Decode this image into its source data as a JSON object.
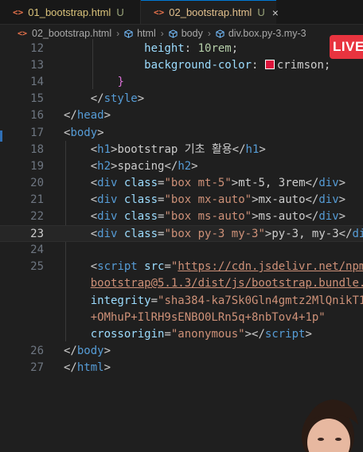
{
  "tabs": [
    {
      "icon": "<>",
      "label": "01_bootstrap.html",
      "modified": "U",
      "active": false
    },
    {
      "icon": "<>",
      "label": "02_bootstrap.html",
      "modified": "U",
      "close": "×",
      "active": true
    }
  ],
  "breadcrumb": [
    {
      "icon": "<>",
      "label": "02_bootstrap.html"
    },
    {
      "icon": "cube",
      "label": "html"
    },
    {
      "icon": "cube",
      "label": "body"
    },
    {
      "icon": "cube",
      "label": "div.box.py-3.my-3"
    }
  ],
  "live_badge": "LIVE",
  "swatch_color": "#dc143c",
  "current_line": "23",
  "lines": [
    {
      "n": "12",
      "html": "            <span class=\"prop\">height</span>: <span class=\"num\">10rem</span>;"
    },
    {
      "n": "13",
      "html": "            <span class=\"prop\">background-color</span>: <span class=\"swatch\"></span>crimson;"
    },
    {
      "n": "14",
      "html": "        <span class=\"brace\">}</span>"
    },
    {
      "n": "15",
      "html": "    &lt;/<span class=\"tag\">style</span>&gt;"
    },
    {
      "n": "16",
      "html": "&lt;/<span class=\"tag\">head</span>&gt;"
    },
    {
      "n": "17",
      "html": "&lt;<span class=\"tag\">body</span>&gt;"
    },
    {
      "n": "18",
      "html": "    &lt;<span class=\"tag\">h1</span>&gt;bootstrap 기초 활용&lt;/<span class=\"tag\">h1</span>&gt;"
    },
    {
      "n": "19",
      "html": "    &lt;<span class=\"tag\">h2</span>&gt;spacing&lt;/<span class=\"tag\">h2</span>&gt;"
    },
    {
      "n": "20",
      "html": "    &lt;<span class=\"tag\">div</span> <span class=\"attr\">class</span>=<span class=\"str\">\"box mt-5\"</span>&gt;mt-5, 3rem&lt;/<span class=\"tag\">div</span>&gt;"
    },
    {
      "n": "21",
      "html": "    &lt;<span class=\"tag\">div</span> <span class=\"attr\">class</span>=<span class=\"str\">\"box mx-auto\"</span>&gt;mx-auto&lt;/<span class=\"tag\">div</span>&gt;"
    },
    {
      "n": "22",
      "html": "    &lt;<span class=\"tag\">div</span> <span class=\"attr\">class</span>=<span class=\"str\">\"box ms-auto\"</span>&gt;ms-auto&lt;/<span class=\"tag\">div</span>&gt;"
    },
    {
      "n": "23",
      "html": "    &lt;<span class=\"tag\">div</span> <span class=\"attr\">class</span>=<span class=\"str\">\"box py-3 my-3\"</span>&gt;py-3, my-3&lt;/<span class=\"tag\">di</span>"
    },
    {
      "n": "24",
      "html": ""
    },
    {
      "n": "25",
      "html": "    &lt;<span class=\"tag\">script</span> <span class=\"attr\">src</span>=<span class=\"str\">\"<span class=\"url\">https://cdn.jsdelivr.net/npm</span></span>"
    },
    {
      "n": "",
      "html": "    <span class=\"str\"><span class=\"url\">bootstrap@5.1.3/dist/js/bootstrap.bundle.</span></span>"
    },
    {
      "n": "",
      "html": "    <span class=\"attr\">integrity</span>=<span class=\"str\">\"sha384-ka7Sk0Gln4gmtz2MlQnikT1</span>"
    },
    {
      "n": "",
      "html": "    <span class=\"str\">+OMhuP+IlRH9sENBO0LRn5q+8nbTov4+1p\"</span>"
    },
    {
      "n": "",
      "html": "    <span class=\"attr\">crossorigin</span>=<span class=\"str\">\"anonymous\"</span>&gt;&lt;/<span class=\"tag\">script</span>&gt;"
    },
    {
      "n": "26",
      "html": "&lt;/<span class=\"tag\">body</span>&gt;"
    },
    {
      "n": "27",
      "html": "&lt;/<span class=\"tag\">html</span>&gt;"
    }
  ]
}
